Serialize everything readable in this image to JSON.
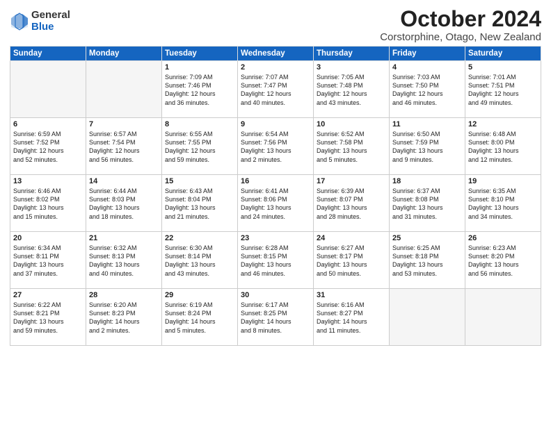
{
  "logo": {
    "general": "General",
    "blue": "Blue"
  },
  "title": "October 2024",
  "location": "Corstorphine, Otago, New Zealand",
  "weekdays": [
    "Sunday",
    "Monday",
    "Tuesday",
    "Wednesday",
    "Thursday",
    "Friday",
    "Saturday"
  ],
  "weeks": [
    [
      {
        "day": "",
        "content": ""
      },
      {
        "day": "",
        "content": ""
      },
      {
        "day": "1",
        "content": "Sunrise: 7:09 AM\nSunset: 7:46 PM\nDaylight: 12 hours\nand 36 minutes."
      },
      {
        "day": "2",
        "content": "Sunrise: 7:07 AM\nSunset: 7:47 PM\nDaylight: 12 hours\nand 40 minutes."
      },
      {
        "day": "3",
        "content": "Sunrise: 7:05 AM\nSunset: 7:48 PM\nDaylight: 12 hours\nand 43 minutes."
      },
      {
        "day": "4",
        "content": "Sunrise: 7:03 AM\nSunset: 7:50 PM\nDaylight: 12 hours\nand 46 minutes."
      },
      {
        "day": "5",
        "content": "Sunrise: 7:01 AM\nSunset: 7:51 PM\nDaylight: 12 hours\nand 49 minutes."
      }
    ],
    [
      {
        "day": "6",
        "content": "Sunrise: 6:59 AM\nSunset: 7:52 PM\nDaylight: 12 hours\nand 52 minutes."
      },
      {
        "day": "7",
        "content": "Sunrise: 6:57 AM\nSunset: 7:54 PM\nDaylight: 12 hours\nand 56 minutes."
      },
      {
        "day": "8",
        "content": "Sunrise: 6:55 AM\nSunset: 7:55 PM\nDaylight: 12 hours\nand 59 minutes."
      },
      {
        "day": "9",
        "content": "Sunrise: 6:54 AM\nSunset: 7:56 PM\nDaylight: 13 hours\nand 2 minutes."
      },
      {
        "day": "10",
        "content": "Sunrise: 6:52 AM\nSunset: 7:58 PM\nDaylight: 13 hours\nand 5 minutes."
      },
      {
        "day": "11",
        "content": "Sunrise: 6:50 AM\nSunset: 7:59 PM\nDaylight: 13 hours\nand 9 minutes."
      },
      {
        "day": "12",
        "content": "Sunrise: 6:48 AM\nSunset: 8:00 PM\nDaylight: 13 hours\nand 12 minutes."
      }
    ],
    [
      {
        "day": "13",
        "content": "Sunrise: 6:46 AM\nSunset: 8:02 PM\nDaylight: 13 hours\nand 15 minutes."
      },
      {
        "day": "14",
        "content": "Sunrise: 6:44 AM\nSunset: 8:03 PM\nDaylight: 13 hours\nand 18 minutes."
      },
      {
        "day": "15",
        "content": "Sunrise: 6:43 AM\nSunset: 8:04 PM\nDaylight: 13 hours\nand 21 minutes."
      },
      {
        "day": "16",
        "content": "Sunrise: 6:41 AM\nSunset: 8:06 PM\nDaylight: 13 hours\nand 24 minutes."
      },
      {
        "day": "17",
        "content": "Sunrise: 6:39 AM\nSunset: 8:07 PM\nDaylight: 13 hours\nand 28 minutes."
      },
      {
        "day": "18",
        "content": "Sunrise: 6:37 AM\nSunset: 8:08 PM\nDaylight: 13 hours\nand 31 minutes."
      },
      {
        "day": "19",
        "content": "Sunrise: 6:35 AM\nSunset: 8:10 PM\nDaylight: 13 hours\nand 34 minutes."
      }
    ],
    [
      {
        "day": "20",
        "content": "Sunrise: 6:34 AM\nSunset: 8:11 PM\nDaylight: 13 hours\nand 37 minutes."
      },
      {
        "day": "21",
        "content": "Sunrise: 6:32 AM\nSunset: 8:13 PM\nDaylight: 13 hours\nand 40 minutes."
      },
      {
        "day": "22",
        "content": "Sunrise: 6:30 AM\nSunset: 8:14 PM\nDaylight: 13 hours\nand 43 minutes."
      },
      {
        "day": "23",
        "content": "Sunrise: 6:28 AM\nSunset: 8:15 PM\nDaylight: 13 hours\nand 46 minutes."
      },
      {
        "day": "24",
        "content": "Sunrise: 6:27 AM\nSunset: 8:17 PM\nDaylight: 13 hours\nand 50 minutes."
      },
      {
        "day": "25",
        "content": "Sunrise: 6:25 AM\nSunset: 8:18 PM\nDaylight: 13 hours\nand 53 minutes."
      },
      {
        "day": "26",
        "content": "Sunrise: 6:23 AM\nSunset: 8:20 PM\nDaylight: 13 hours\nand 56 minutes."
      }
    ],
    [
      {
        "day": "27",
        "content": "Sunrise: 6:22 AM\nSunset: 8:21 PM\nDaylight: 13 hours\nand 59 minutes."
      },
      {
        "day": "28",
        "content": "Sunrise: 6:20 AM\nSunset: 8:23 PM\nDaylight: 14 hours\nand 2 minutes."
      },
      {
        "day": "29",
        "content": "Sunrise: 6:19 AM\nSunset: 8:24 PM\nDaylight: 14 hours\nand 5 minutes."
      },
      {
        "day": "30",
        "content": "Sunrise: 6:17 AM\nSunset: 8:25 PM\nDaylight: 14 hours\nand 8 minutes."
      },
      {
        "day": "31",
        "content": "Sunrise: 6:16 AM\nSunset: 8:27 PM\nDaylight: 14 hours\nand 11 minutes."
      },
      {
        "day": "",
        "content": ""
      },
      {
        "day": "",
        "content": ""
      }
    ]
  ]
}
